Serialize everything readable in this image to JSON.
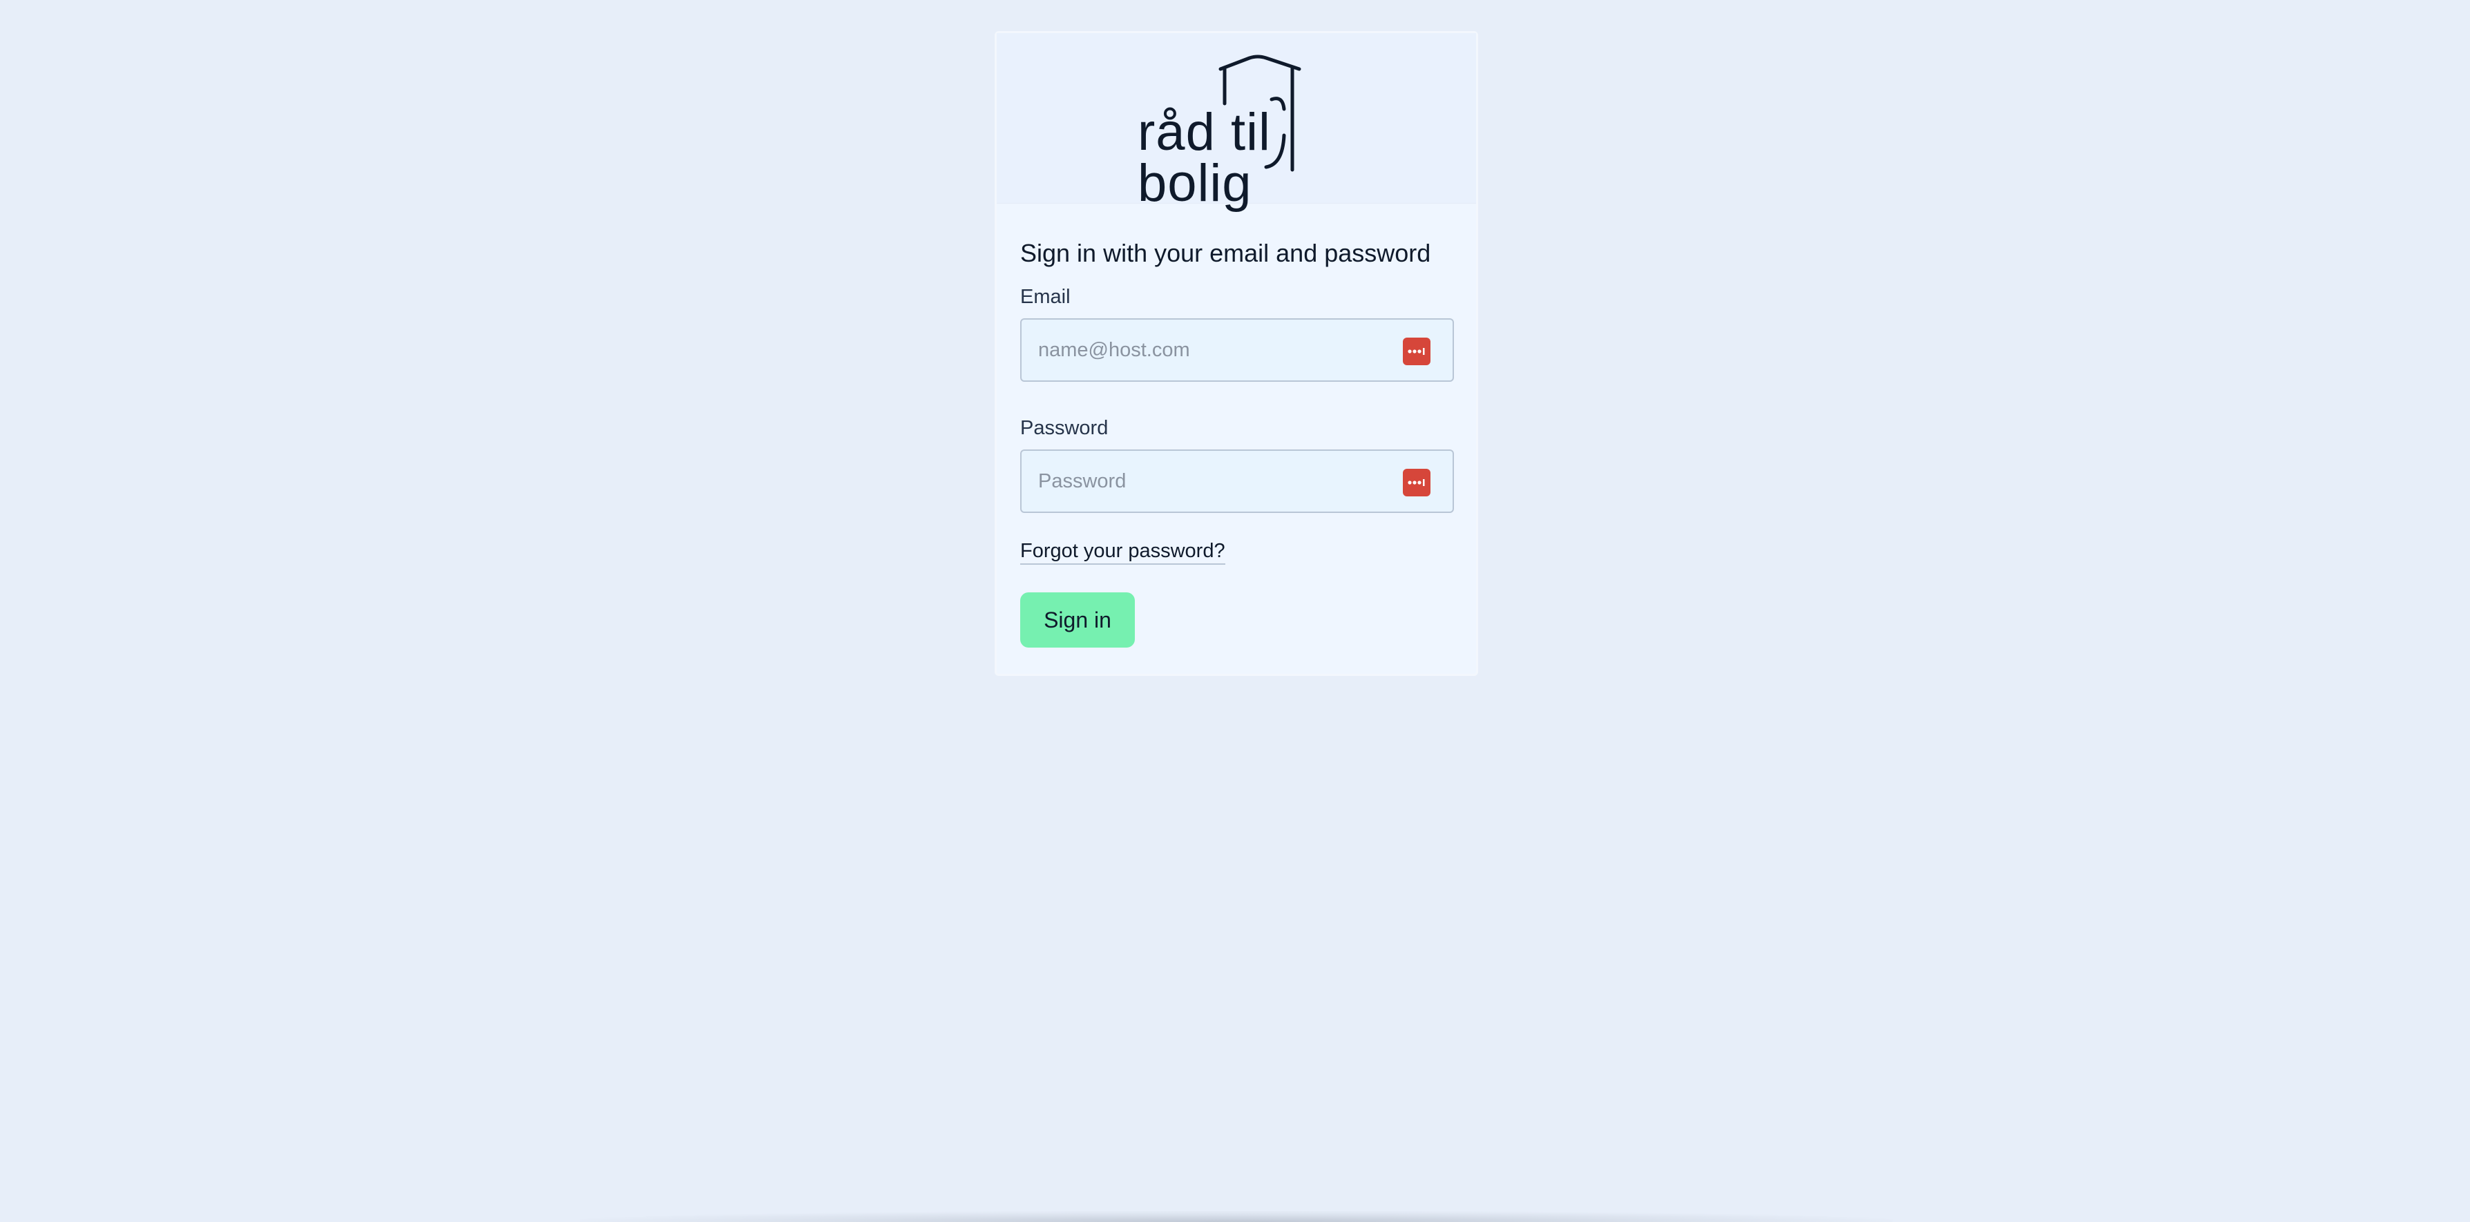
{
  "logo": {
    "line1": "råd til",
    "line2": "bolig",
    "icon": "house-outline-logo"
  },
  "form": {
    "heading": "Sign in with your email and password",
    "email": {
      "label": "Email",
      "placeholder": "name@host.com",
      "value": ""
    },
    "password": {
      "label": "Password",
      "placeholder": "Password",
      "value": ""
    },
    "forgot_label": "Forgot your password?",
    "submit_label": "Sign in",
    "autofill_icon": "password-manager-icon"
  },
  "colors": {
    "background": "#e7eef9",
    "card": "#eff6ff",
    "header": "#e9f1fd",
    "button": "#76f0b0",
    "autofill_icon": "#d6463a",
    "text": "#0f1a2b"
  }
}
